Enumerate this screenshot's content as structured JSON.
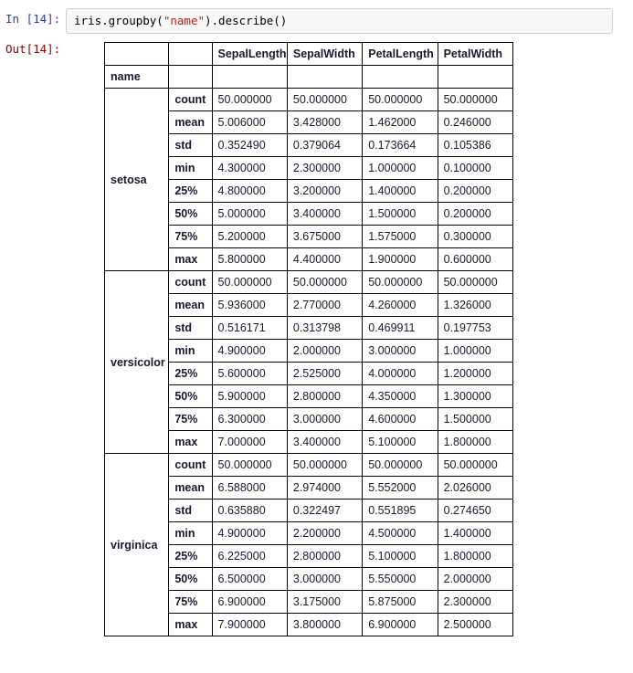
{
  "notebook": {
    "input_prompt": "In [14]:",
    "output_prompt": "Out[14]:",
    "code": {
      "part1": "iris.groupby(",
      "string": "\"name\"",
      "part2": ").describe()"
    },
    "colors": {
      "in_prompt": "#303f9f",
      "out_prompt": "#8b0000",
      "string_literal": "#ba2121",
      "cell_background": "#f7f7f7",
      "cell_border": "#cfcfcf",
      "table_border": "#000000"
    }
  },
  "table": {
    "index_label": "name",
    "columns": [
      "SepalLength",
      "SepalWidth",
      "PetalLength",
      "PetalWidth"
    ],
    "stats": [
      "count",
      "mean",
      "std",
      "min",
      "25%",
      "50%",
      "75%",
      "max"
    ],
    "groups": [
      {
        "name": "setosa",
        "rows": [
          {
            "stat": "count",
            "values": [
              "50.000000",
              "50.000000",
              "50.000000",
              "50.000000"
            ]
          },
          {
            "stat": "mean",
            "values": [
              "5.006000",
              "3.428000",
              "1.462000",
              "0.246000"
            ]
          },
          {
            "stat": "std",
            "values": [
              "0.352490",
              "0.379064",
              "0.173664",
              "0.105386"
            ]
          },
          {
            "stat": "min",
            "values": [
              "4.300000",
              "2.300000",
              "1.000000",
              "0.100000"
            ]
          },
          {
            "stat": "25%",
            "values": [
              "4.800000",
              "3.200000",
              "1.400000",
              "0.200000"
            ]
          },
          {
            "stat": "50%",
            "values": [
              "5.000000",
              "3.400000",
              "1.500000",
              "0.200000"
            ]
          },
          {
            "stat": "75%",
            "values": [
              "5.200000",
              "3.675000",
              "1.575000",
              "0.300000"
            ]
          },
          {
            "stat": "max",
            "values": [
              "5.800000",
              "4.400000",
              "1.900000",
              "0.600000"
            ]
          }
        ]
      },
      {
        "name": "versicolor",
        "rows": [
          {
            "stat": "count",
            "values": [
              "50.000000",
              "50.000000",
              "50.000000",
              "50.000000"
            ]
          },
          {
            "stat": "mean",
            "values": [
              "5.936000",
              "2.770000",
              "4.260000",
              "1.326000"
            ]
          },
          {
            "stat": "std",
            "values": [
              "0.516171",
              "0.313798",
              "0.469911",
              "0.197753"
            ]
          },
          {
            "stat": "min",
            "values": [
              "4.900000",
              "2.000000",
              "3.000000",
              "1.000000"
            ]
          },
          {
            "stat": "25%",
            "values": [
              "5.600000",
              "2.525000",
              "4.000000",
              "1.200000"
            ]
          },
          {
            "stat": "50%",
            "values": [
              "5.900000",
              "2.800000",
              "4.350000",
              "1.300000"
            ]
          },
          {
            "stat": "75%",
            "values": [
              "6.300000",
              "3.000000",
              "4.600000",
              "1.500000"
            ]
          },
          {
            "stat": "max",
            "values": [
              "7.000000",
              "3.400000",
              "5.100000",
              "1.800000"
            ]
          }
        ]
      },
      {
        "name": "virginica",
        "rows": [
          {
            "stat": "count",
            "values": [
              "50.000000",
              "50.000000",
              "50.000000",
              "50.000000"
            ]
          },
          {
            "stat": "mean",
            "values": [
              "6.588000",
              "2.974000",
              "5.552000",
              "2.026000"
            ]
          },
          {
            "stat": "std",
            "values": [
              "0.635880",
              "0.322497",
              "0.551895",
              "0.274650"
            ]
          },
          {
            "stat": "min",
            "values": [
              "4.900000",
              "2.200000",
              "4.500000",
              "1.400000"
            ]
          },
          {
            "stat": "25%",
            "values": [
              "6.225000",
              "2.800000",
              "5.100000",
              "1.800000"
            ]
          },
          {
            "stat": "50%",
            "values": [
              "6.500000",
              "3.000000",
              "5.550000",
              "2.000000"
            ]
          },
          {
            "stat": "75%",
            "values": [
              "6.900000",
              "3.175000",
              "5.875000",
              "2.300000"
            ]
          },
          {
            "stat": "max",
            "values": [
              "7.900000",
              "3.800000",
              "6.900000",
              "2.500000"
            ]
          }
        ]
      }
    ]
  }
}
